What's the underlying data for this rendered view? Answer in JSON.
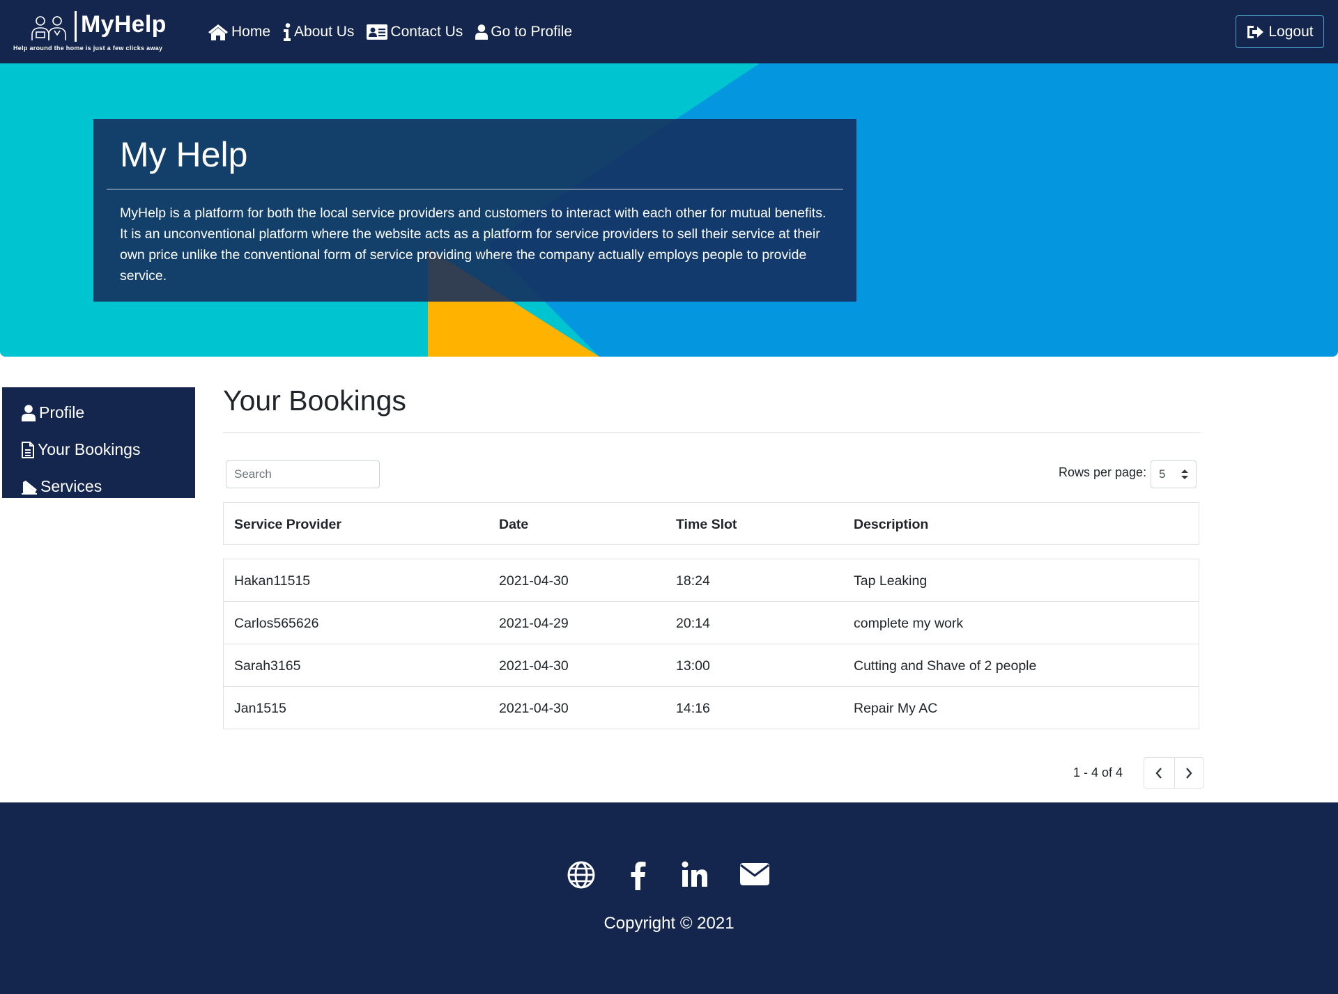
{
  "brand": {
    "name": "MyHelp",
    "tagline": "Help around the home is just a few clicks away"
  },
  "nav": {
    "items": [
      {
        "label": "Home",
        "icon": "home-icon"
      },
      {
        "label": "About Us",
        "icon": "info-icon"
      },
      {
        "label": "Contact Us",
        "icon": "id-card-icon"
      },
      {
        "label": "Go to Profile",
        "icon": "user-icon"
      }
    ],
    "logout_label": "Logout"
  },
  "hero": {
    "title": "My Help",
    "description": "MyHelp is a platform for both the local service providers and customers to interact with each other for mutual benefits. It is an unconventional platform where the website acts as a platform for service providers to sell their service at their own price unlike the conventional form of service providing where the company actually employs people to provide service."
  },
  "sidebar": {
    "items": [
      {
        "label": "Profile",
        "icon": "user-icon"
      },
      {
        "label": "Your Bookings",
        "icon": "file-icon"
      },
      {
        "label": "Services",
        "icon": "services-icon"
      }
    ]
  },
  "main": {
    "title": "Your Bookings",
    "search_placeholder": "Search",
    "rows_per_page_label": "Rows per page:",
    "rows_per_page_value": "5",
    "columns": [
      "Service Provider",
      "Date",
      "Time Slot",
      "Description"
    ],
    "rows": [
      [
        "Hakan11515",
        "2021-04-30",
        "18:24",
        "Tap Leaking"
      ],
      [
        "Carlos565626",
        "2021-04-29",
        "20:14",
        "complete my work"
      ],
      [
        "Sarah3165",
        "2021-04-30",
        "13:00",
        "Cutting and Shave of 2 people"
      ],
      [
        "Jan1515",
        "2021-04-30",
        "14:16",
        "Repair My AC"
      ]
    ],
    "pagination_text": "1 - 4 of 4"
  },
  "footer": {
    "social_icons": [
      "globe-icon",
      "facebook-icon",
      "linkedin-icon",
      "envelope-icon"
    ],
    "copyright": "Copyright © 2021"
  },
  "colors": {
    "navy": "#14264e",
    "hero_cyan": "#00c5d1",
    "hero_blue": "#0497e0",
    "hero_yellow": "#ffb200"
  }
}
